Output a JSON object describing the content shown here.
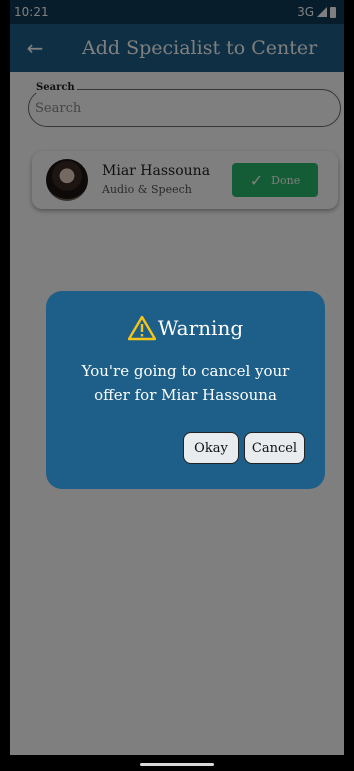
{
  "status_bar": {
    "time": "10:21",
    "network": "3G"
  },
  "app_bar": {
    "title": "Add Specialist to Center",
    "back_icon": "arrow-left-icon"
  },
  "search": {
    "label": "Search",
    "placeholder": "Search",
    "value": ""
  },
  "specialists": [
    {
      "name": "Miar Hassouna",
      "role": "Audio & Speech",
      "action_label": "Done",
      "action_color": "#27b86a"
    }
  ],
  "dialog": {
    "title": "Warning",
    "icon": "warning-icon",
    "message": "You're going to cancel your offer for Miar Hassouna",
    "okay_label": "Okay",
    "cancel_label": "Cancel"
  },
  "colors": {
    "primary": "#1e5f89",
    "status_bar": "#0e3a57",
    "success": "#27b86a",
    "warning": "#f5c518"
  }
}
